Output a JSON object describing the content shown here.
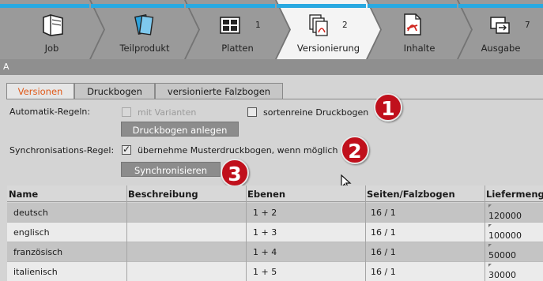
{
  "steps": [
    {
      "label": "Job",
      "icon": "job-folder-icon",
      "num": ""
    },
    {
      "label": "Teilprodukt",
      "icon": "partial-product-icon",
      "num": ""
    },
    {
      "label": "Platten",
      "icon": "plates-icon",
      "num": "1"
    },
    {
      "label": "Versionierung",
      "icon": "versioning-icon",
      "num": "2"
    },
    {
      "label": "Inhalte",
      "icon": "contents-pdf-icon",
      "num": ""
    },
    {
      "label": "Ausgabe",
      "icon": "output-icon",
      "num": "7"
    }
  ],
  "section_header": "A",
  "tabs": [
    "Versionen",
    "Druckbogen",
    "versionierte Falzbogen"
  ],
  "auto_rules": {
    "label": "Automatik-Regeln:",
    "with_variants": "mit Varianten",
    "sorted_sheets": "sortenreine Druckbogen",
    "create_button": "Druckbogen anlegen"
  },
  "sync_rule": {
    "label": "Synchronisations-Regel:",
    "adopt_master": "übernehme Musterdruckbogen, wenn möglich",
    "sync_button": "Synchronisieren"
  },
  "callouts": [
    "1",
    "2",
    "3"
  ],
  "table": {
    "headers": [
      "Name",
      "Beschreibung",
      "Ebenen",
      "Seiten/Falzbogen",
      "Liefermenge"
    ],
    "rows": [
      {
        "name": "deutsch",
        "desc": "",
        "layers": "1 + 2",
        "pages": "16 / 1",
        "qty": "120000"
      },
      {
        "name": "englisch",
        "desc": "",
        "layers": "1 + 3",
        "pages": "16 / 1",
        "qty": "100000"
      },
      {
        "name": "französisch",
        "desc": "",
        "layers": "1 + 4",
        "pages": "16 / 1",
        "qty": "50000"
      },
      {
        "name": "italienisch",
        "desc": "",
        "layers": "1 + 5",
        "pages": "16 / 1",
        "qty": "30000"
      }
    ]
  },
  "colors": {
    "accent_blue": "#29a9e1",
    "active_tab_text": "#e05a1a",
    "callout_red": "#c0101c"
  }
}
